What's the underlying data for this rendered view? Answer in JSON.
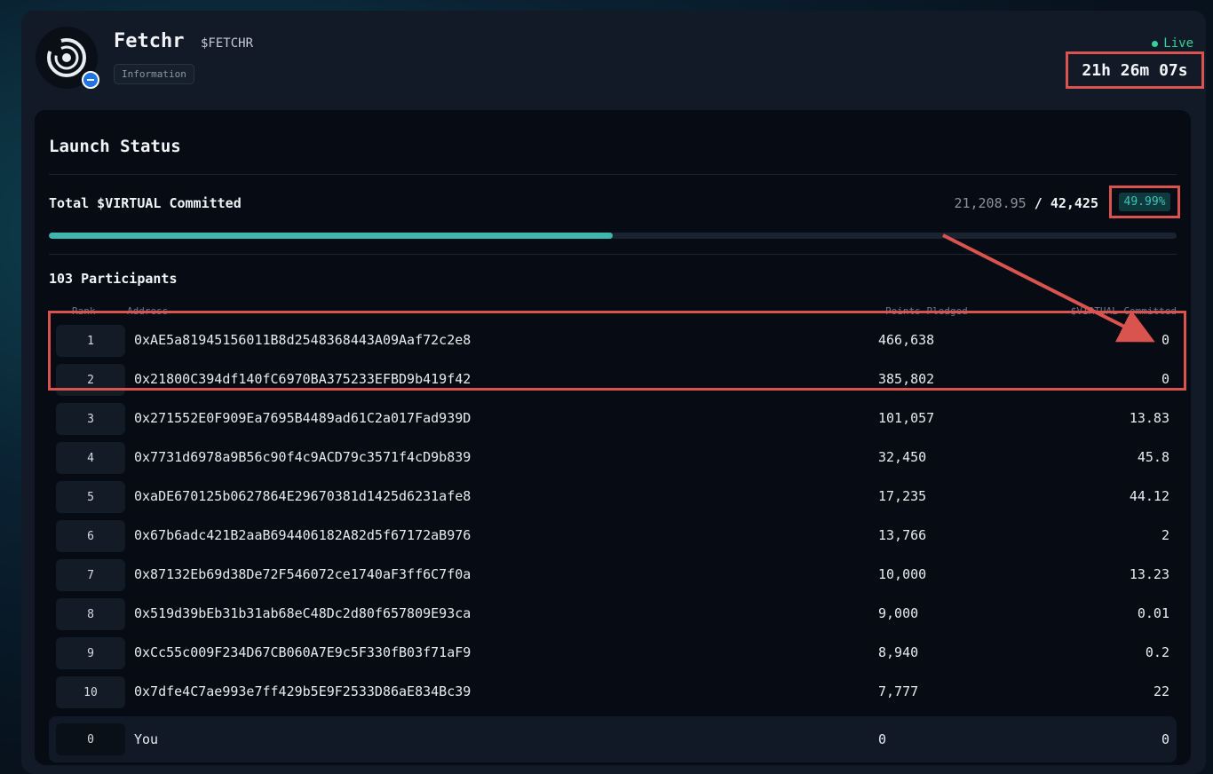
{
  "token": {
    "name": "Fetchr",
    "ticker": "$FETCHR",
    "info_tag": "Information"
  },
  "status": {
    "live_label": "Live",
    "countdown": "21h 26m 07s"
  },
  "launch": {
    "title": "Launch Status",
    "total_label": "Total $VIRTUAL Committed",
    "committed": "21,208.95",
    "separator": "/",
    "target": "42,425",
    "percent": "49.99%",
    "progress_fraction": 0.4999
  },
  "participants": {
    "count_label": "103 Participants",
    "columns": {
      "rank": "Rank",
      "address": "Address",
      "points": "Points Pledged",
      "committed": "$VIRTUAL Committed"
    },
    "rows": [
      {
        "rank": "1",
        "address": "0xAE5a81945156011B8d2548368443A09Aaf72c2e8",
        "points": "466,638",
        "committed": "0"
      },
      {
        "rank": "2",
        "address": "0x21800C394df140fC6970BA375233EFBD9b419f42",
        "points": "385,802",
        "committed": "0"
      },
      {
        "rank": "3",
        "address": "0x271552E0F909Ea7695B4489ad61C2a017Fad939D",
        "points": "101,057",
        "committed": "13.83"
      },
      {
        "rank": "4",
        "address": "0x7731d6978a9B56c90f4c9ACD79c3571f4cD9b839",
        "points": "32,450",
        "committed": "45.8"
      },
      {
        "rank": "5",
        "address": "0xaDE670125b0627864E29670381d1425d6231afe8",
        "points": "17,235",
        "committed": "44.12"
      },
      {
        "rank": "6",
        "address": "0x67b6adc421B2aaB694406182A82d5f67172aB976",
        "points": "13,766",
        "committed": "2"
      },
      {
        "rank": "7",
        "address": "0x87132Eb69d38De72F546072ce1740aF3ff6C7f0a",
        "points": "10,000",
        "committed": "13.23"
      },
      {
        "rank": "8",
        "address": "0x519d39bEb31b31ab68eC48Dc2d80f657809E93ca",
        "points": "9,000",
        "committed": "0.01"
      },
      {
        "rank": "9",
        "address": "0xCc55c009F234D67CB060A7E9c5F330fB03f71aF9",
        "points": "8,940",
        "committed": "0.2"
      },
      {
        "rank": "10",
        "address": "0x7dfe4C7ae993e7ff429b5E9F2533D86aE834Bc39",
        "points": "7,777",
        "committed": "22"
      }
    ],
    "you": {
      "rank": "0",
      "address": "You",
      "points": "0",
      "committed": "0"
    }
  },
  "colors": {
    "accent": "#3fb6b0",
    "live": "#34d399",
    "annotation": "#d9534f"
  },
  "icons": {
    "logo": "eye-swirl-icon",
    "badge": "chain-badge-icon"
  }
}
